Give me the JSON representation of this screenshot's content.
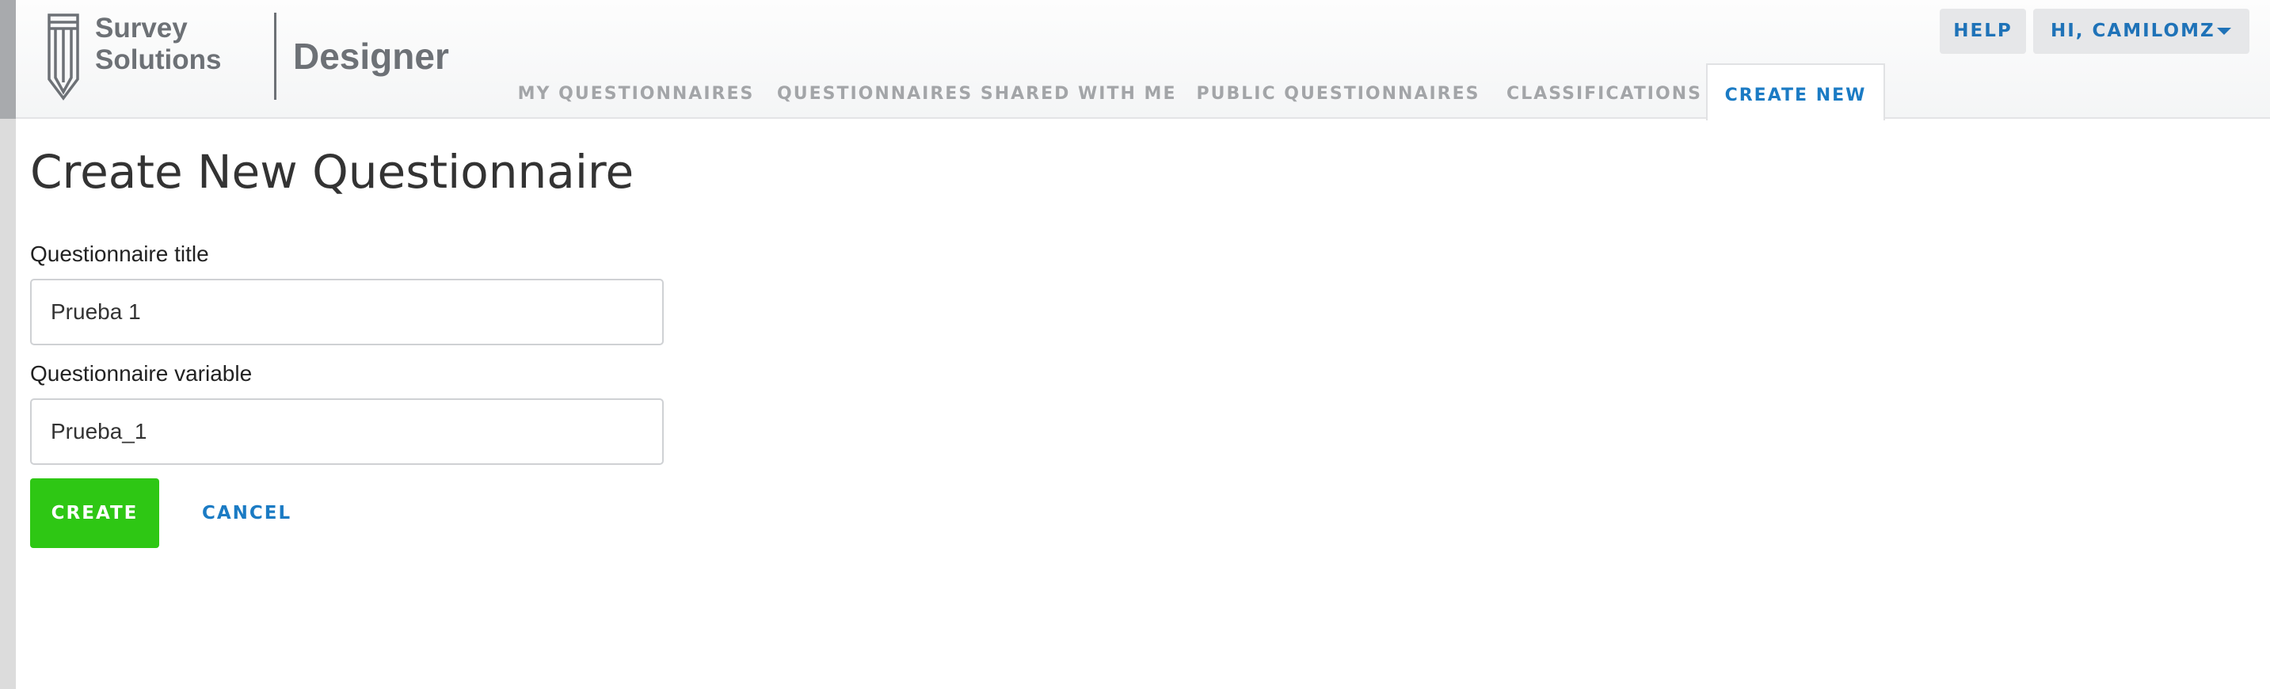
{
  "header": {
    "brand": {
      "line1": "Survey",
      "line2": "Solutions",
      "product": "Designer",
      "logo_icon": "pen-nib-icon"
    },
    "nav_tabs": [
      {
        "label": "MY QUESTIONNAIRES",
        "active": false
      },
      {
        "label": "QUESTIONNAIRES SHARED WITH ME",
        "active": false
      },
      {
        "label": "PUBLIC QUESTIONNAIRES",
        "active": false
      },
      {
        "label": "CLASSIFICATIONS",
        "active": false
      },
      {
        "label": "CREATE NEW",
        "active": true
      }
    ],
    "help_label": "HELP",
    "user_label": "HI, CAMILOMZ",
    "user_menu_icon": "caret-down-icon"
  },
  "main": {
    "title": "Create New Questionnaire",
    "fields": {
      "title": {
        "label": "Questionnaire title",
        "value": "Prueba 1"
      },
      "variable": {
        "label": "Questionnaire variable",
        "value": "Prueba_1"
      }
    },
    "create_label": "CREATE",
    "cancel_label": "CANCEL"
  },
  "colors": {
    "accent": "#1b7bc4",
    "create_button": "#2ec714",
    "header_text": "#6d7176",
    "inactive_tab": "#a3a5a8"
  }
}
